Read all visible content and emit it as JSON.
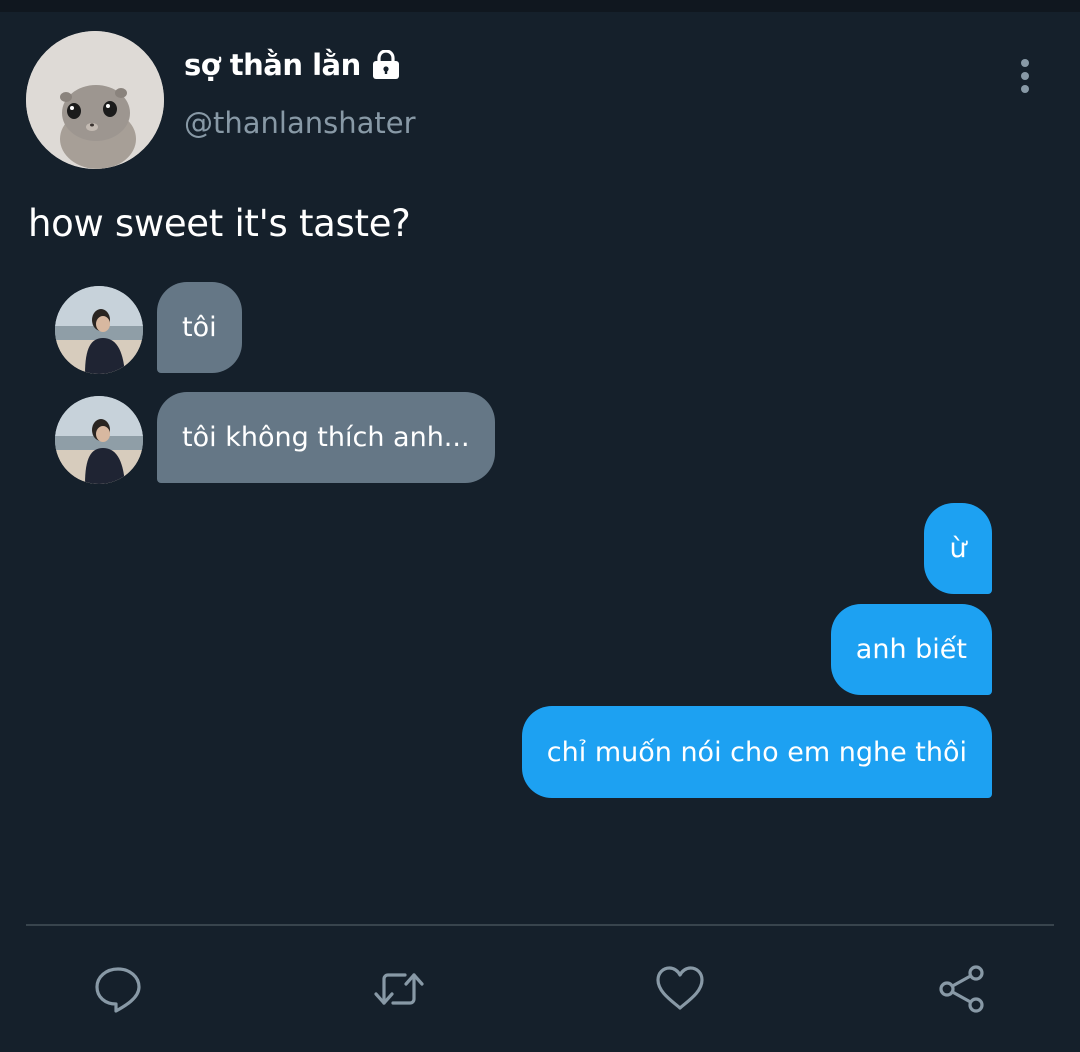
{
  "tweet": {
    "display_name": "sợ thằn lằn",
    "handle": "@thanlanshater",
    "text": "how sweet it's taste?"
  },
  "messages": [
    {
      "side": "incoming",
      "text": "tôi"
    },
    {
      "side": "incoming",
      "text": "tôi không thích anh..."
    },
    {
      "side": "outgoing",
      "text": "ừ"
    },
    {
      "side": "outgoing",
      "text": "anh biết"
    },
    {
      "side": "outgoing",
      "text": "chỉ muốn nói cho em nghe thôi"
    }
  ],
  "icons": {
    "lock": "lock-icon",
    "more": "more-vertical-icon",
    "reply": "reply-icon",
    "retweet": "retweet-icon",
    "like": "heart-icon",
    "share": "share-icon"
  },
  "colors": {
    "background": "#15202b",
    "incoming_bubble": "#657786",
    "outgoing_bubble": "#1da1f2",
    "secondary_text": "#8899a6"
  }
}
